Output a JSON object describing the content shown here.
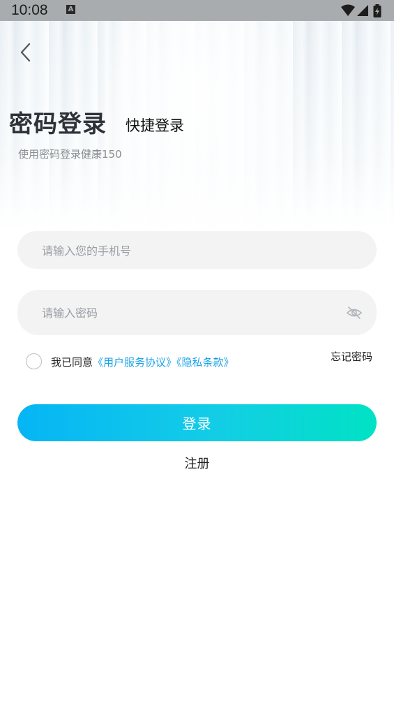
{
  "status_bar": {
    "time": "10:08",
    "notification_glyph": "A",
    "icons": [
      "wifi-icon",
      "signal-icon",
      "battery-charging-icon"
    ]
  },
  "header": {
    "back_icon": "chevron-left-icon",
    "title_active": "密码登录",
    "title_alternate": "快捷登录",
    "subtitle": "使用密码登录健康150"
  },
  "form": {
    "phone": {
      "value": "",
      "placeholder": "请输入您的手机号"
    },
    "password": {
      "value": "",
      "placeholder": "请输入密码",
      "visibility_icon": "eye-off-icon"
    },
    "agreement": {
      "checked": false,
      "prefix": "我已同意",
      "terms_link": "《用户服务协议》",
      "privacy_link": "《隐私条款》"
    },
    "forgot_password": "忘记密码",
    "login_button": "登录",
    "register_link": "注册"
  },
  "colors": {
    "accent_start": "#06b5f5",
    "accent_end": "#00e2c4",
    "link": "#1aa3e8",
    "field_bg": "#f3f3f4"
  }
}
